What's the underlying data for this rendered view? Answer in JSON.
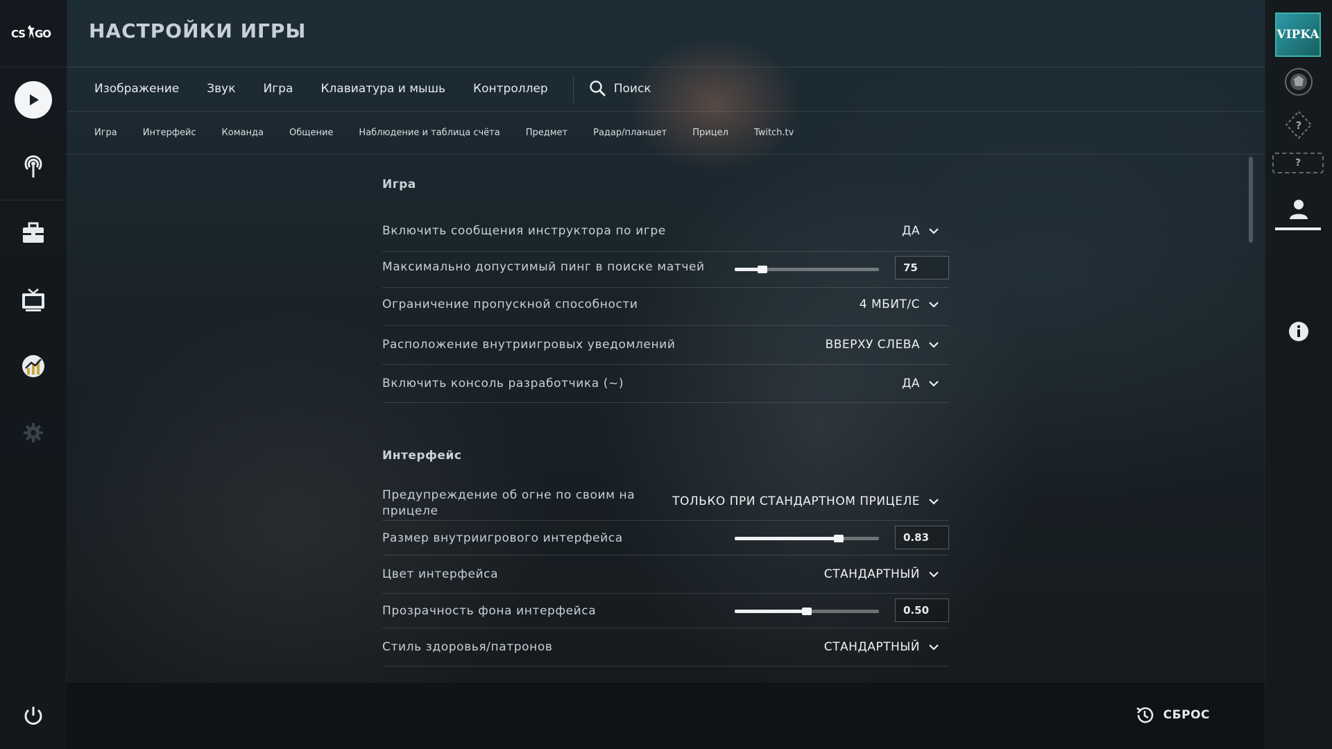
{
  "app": {
    "logo_text": "CS:GO",
    "title": "НАСТРОЙКИ ИГРЫ"
  },
  "main_tabs": [
    {
      "label": "Изображение"
    },
    {
      "label": "Звук"
    },
    {
      "label": "Игра"
    },
    {
      "label": "Клавиатура и мышь"
    },
    {
      "label": "Контроллер"
    }
  ],
  "search": {
    "label": "Поиск",
    "icon": "search-icon"
  },
  "sub_tabs": [
    {
      "label": "Игра"
    },
    {
      "label": "Интерфейс"
    },
    {
      "label": "Команда"
    },
    {
      "label": "Общение"
    },
    {
      "label": "Наблюдение и таблица счёта"
    },
    {
      "label": "Предмет"
    },
    {
      "label": "Радар/планшет"
    },
    {
      "label": "Прицел"
    },
    {
      "label": "Twitch.tv"
    }
  ],
  "sections": {
    "game": {
      "title": "Игра",
      "rows": [
        {
          "label": "Включить сообщения инструктора по игре",
          "type": "dropdown",
          "value": "ДА"
        },
        {
          "label": "Максимально допустимый пинг в поиске матчей",
          "type": "slider",
          "value": "75",
          "level": 0.19
        },
        {
          "label": "Ограничение пропускной способности",
          "type": "dropdown",
          "value": "4 МБИТ/С"
        },
        {
          "label": "Расположение внутриигровых уведомлений",
          "type": "dropdown",
          "value": "ВВЕРХУ СЛЕВА"
        },
        {
          "label": "Включить консоль разработчика (~)",
          "type": "dropdown",
          "value": "ДА"
        }
      ]
    },
    "interface": {
      "title": "Интерфейс",
      "rows": [
        {
          "label": "Предупреждение об огне по своим на прицеле",
          "type": "dropdown",
          "value": "ТОЛЬКО ПРИ СТАНДАРТНОМ ПРИЦЕЛЕ"
        },
        {
          "label": "Размер внутриигрового интерфейса",
          "type": "slider",
          "value": "0.83",
          "level": 0.72
        },
        {
          "label": "Цвет интерфейса",
          "type": "dropdown",
          "value": "СТАНДАРТНЫЙ"
        },
        {
          "label": "Прозрачность фона интерфейса",
          "type": "slider",
          "value": "0.50",
          "level": 0.5
        },
        {
          "label": "Стиль здоровья/патронов",
          "type": "dropdown",
          "value": "СТАНДАРТНЫЙ"
        }
      ]
    }
  },
  "profile": {
    "avatar_text": "VIPKA"
  },
  "footer": {
    "reset_label": "СБРОС"
  },
  "colors": {
    "accent": "#eef1f3",
    "avatar_border": "#3db3a8"
  }
}
